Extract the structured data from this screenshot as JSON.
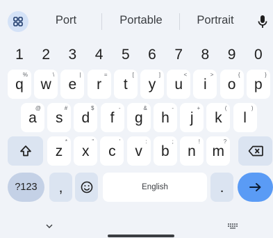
{
  "suggestions": [
    "Port",
    "Portable",
    "Portrait"
  ],
  "number_row": [
    "1",
    "2",
    "3",
    "4",
    "5",
    "6",
    "7",
    "8",
    "9",
    "0"
  ],
  "row1": [
    {
      "k": "q",
      "s": "%"
    },
    {
      "k": "w",
      "s": "\\"
    },
    {
      "k": "e",
      "s": "|"
    },
    {
      "k": "r",
      "s": "="
    },
    {
      "k": "t",
      "s": "["
    },
    {
      "k": "y",
      "s": "]"
    },
    {
      "k": "u",
      "s": "<"
    },
    {
      "k": "i",
      "s": ">"
    },
    {
      "k": "o",
      "s": "{"
    },
    {
      "k": "p",
      "s": "}"
    }
  ],
  "row2": [
    {
      "k": "a",
      "s": "@"
    },
    {
      "k": "s",
      "s": "#"
    },
    {
      "k": "d",
      "s": "$"
    },
    {
      "k": "f",
      "s": "-"
    },
    {
      "k": "g",
      "s": "&"
    },
    {
      "k": "h",
      "s": "-"
    },
    {
      "k": "j",
      "s": "+"
    },
    {
      "k": "k",
      "s": "("
    },
    {
      "k": "l",
      "s": ")"
    }
  ],
  "row3": [
    {
      "k": "z",
      "s": "*"
    },
    {
      "k": "x",
      "s": "\""
    },
    {
      "k": "c",
      "s": "'"
    },
    {
      "k": "v",
      "s": ":"
    },
    {
      "k": "b",
      "s": ";"
    },
    {
      "k": "n",
      "s": "!"
    },
    {
      "k": "m",
      "s": "?"
    }
  ],
  "bottom": {
    "symbols_label": "?123",
    "comma": ",",
    "space_label": "English",
    "period": "."
  },
  "colors": {
    "background": "#f0f3f8",
    "key": "#ffffff",
    "function_key": "#dbe4f1",
    "symbols_key": "#c4d1e6",
    "enter": "#5a9bf5"
  }
}
